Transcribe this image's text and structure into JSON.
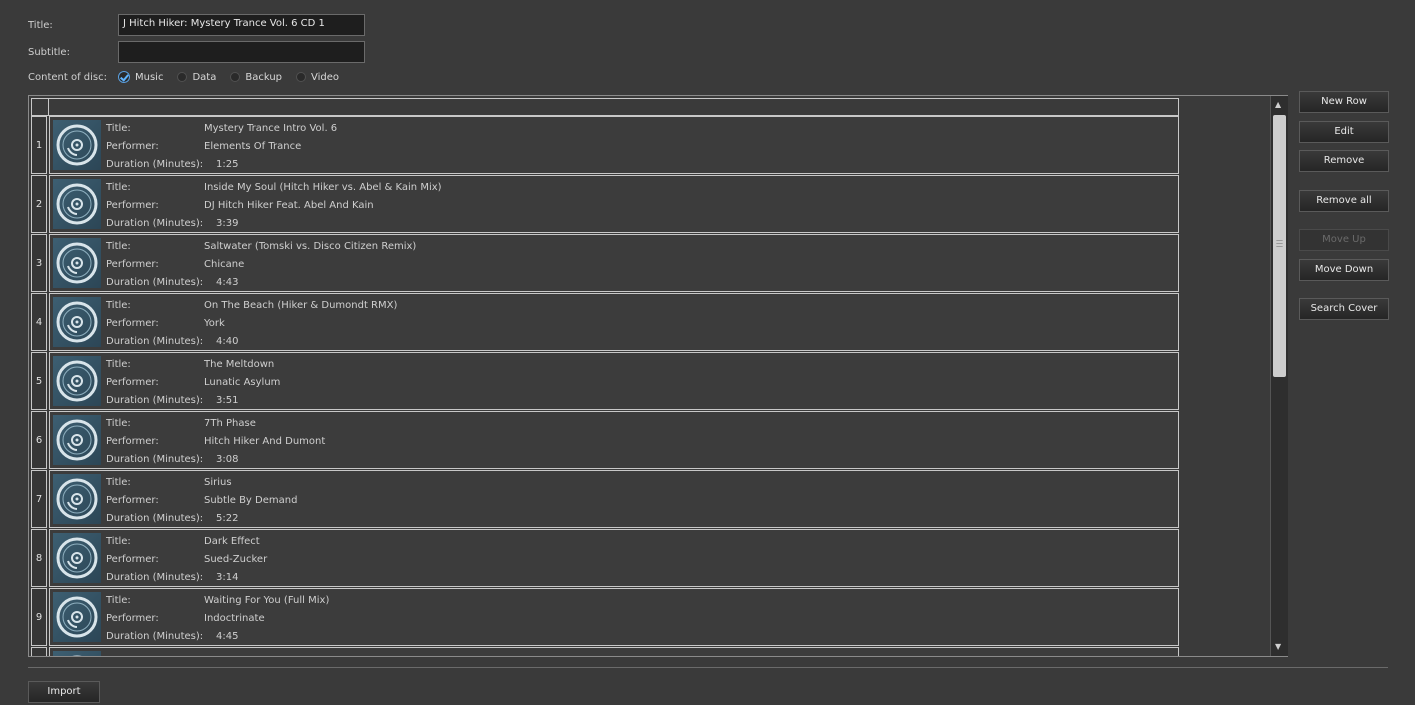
{
  "disc": {
    "title_label": "Title:",
    "title_value": "J Hitch Hiker: Mystery Trance Vol. 6 CD 1",
    "subtitle_label": "Subtitle:",
    "subtitle_value": "",
    "content_label": "Content of disc:",
    "content_options": [
      "Music",
      "Data",
      "Backup",
      "Video"
    ],
    "content_selected": "Music"
  },
  "field_labels": {
    "title": "Title:",
    "performer": "Performer:",
    "duration": "Duration (Minutes):"
  },
  "tracks": [
    {
      "num": "1",
      "title": "Mystery Trance Intro Vol. 6",
      "performer": "Elements Of Trance",
      "duration": "1:25"
    },
    {
      "num": "2",
      "title": "Inside My Soul (Hitch Hiker vs. Abel & Kain Mix)",
      "performer": "DJ Hitch Hiker Feat. Abel And Kain",
      "duration": "3:39"
    },
    {
      "num": "3",
      "title": "Saltwater (Tomski vs. Disco Citizen Remix)",
      "performer": "Chicane",
      "duration": "4:43"
    },
    {
      "num": "4",
      "title": "On The Beach (Hiker & Dumondt RMX)",
      "performer": "York",
      "duration": "4:40"
    },
    {
      "num": "5",
      "title": "The Meltdown",
      "performer": "Lunatic Asylum",
      "duration": "3:51"
    },
    {
      "num": "6",
      "title": "7Th Phase",
      "performer": "Hitch Hiker And Dumont",
      "duration": "3:08"
    },
    {
      "num": "7",
      "title": "Sirius",
      "performer": "Subtle By Demand",
      "duration": "5:22"
    },
    {
      "num": "8",
      "title": "Dark Effect",
      "performer": "Sued-Zucker",
      "duration": "3:14"
    },
    {
      "num": "9",
      "title": "Waiting For You (Full Mix)",
      "performer": "Indoctrinate",
      "duration": "4:45"
    }
  ],
  "buttons": {
    "new_row": "New Row",
    "edit": "Edit",
    "remove": "Remove",
    "remove_all": "Remove all",
    "move_up": "Move Up",
    "move_down": "Move Down",
    "search_cover": "Search Cover",
    "import": "Import"
  },
  "icons": {
    "scroll_up": "scroll-up-arrow-icon",
    "scroll_down": "scroll-down-arrow-icon",
    "cover": "cd-disc-icon"
  },
  "colors": {
    "background": "#3a3a3a",
    "accent": "#5fb4ff"
  }
}
